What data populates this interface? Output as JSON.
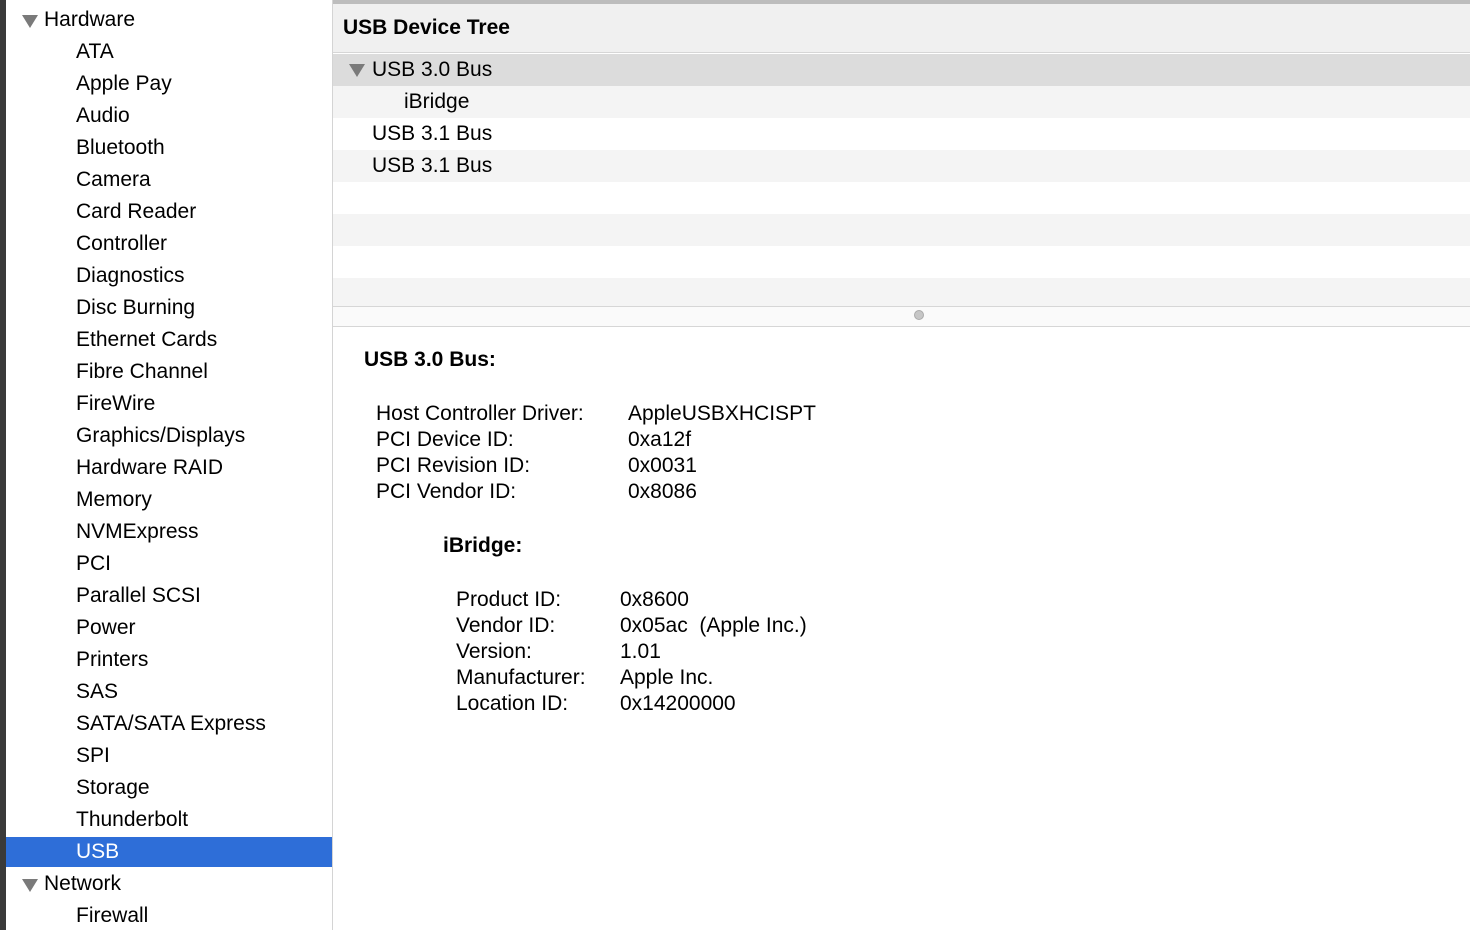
{
  "sidebar": {
    "sections": [
      {
        "label": "Hardware",
        "items": [
          "ATA",
          "Apple Pay",
          "Audio",
          "Bluetooth",
          "Camera",
          "Card Reader",
          "Controller",
          "Diagnostics",
          "Disc Burning",
          "Ethernet Cards",
          "Fibre Channel",
          "FireWire",
          "Graphics/Displays",
          "Hardware RAID",
          "Memory",
          "NVMExpress",
          "PCI",
          "Parallel SCSI",
          "Power",
          "Printers",
          "SAS",
          "SATA/SATA Express",
          "SPI",
          "Storage",
          "Thunderbolt",
          "USB"
        ]
      },
      {
        "label": "Network",
        "items": [
          "Firewall"
        ]
      }
    ],
    "selected": "USB",
    "selection_color": "#2e6ed8"
  },
  "tree": {
    "header": "USB Device Tree",
    "rows": [
      {
        "label": "USB 3.0 Bus",
        "expanded": true
      },
      {
        "label": "iBridge"
      },
      {
        "label": "USB 3.1 Bus"
      },
      {
        "label": "USB 3.1 Bus"
      }
    ]
  },
  "detail": {
    "title": "USB 3.0 Bus:",
    "fields": [
      {
        "label": "Host Controller Driver:",
        "value": "AppleUSBXHCISPT"
      },
      {
        "label": "PCI Device ID:",
        "value": "0xa12f"
      },
      {
        "label": "PCI Revision ID:",
        "value": "0x0031"
      },
      {
        "label": "PCI Vendor ID:",
        "value": "0x8086"
      }
    ],
    "child": {
      "title": "iBridge:",
      "fields": [
        {
          "label": "Product ID:",
          "value": "0x8600"
        },
        {
          "label": "Vendor ID:",
          "value": "0x05ac  (Apple Inc.)"
        },
        {
          "label": "Version:",
          "value": "1.01"
        },
        {
          "label": "Manufacturer:",
          "value": "Apple Inc."
        },
        {
          "label": "Location ID:",
          "value": "0x14200000"
        }
      ]
    }
  }
}
